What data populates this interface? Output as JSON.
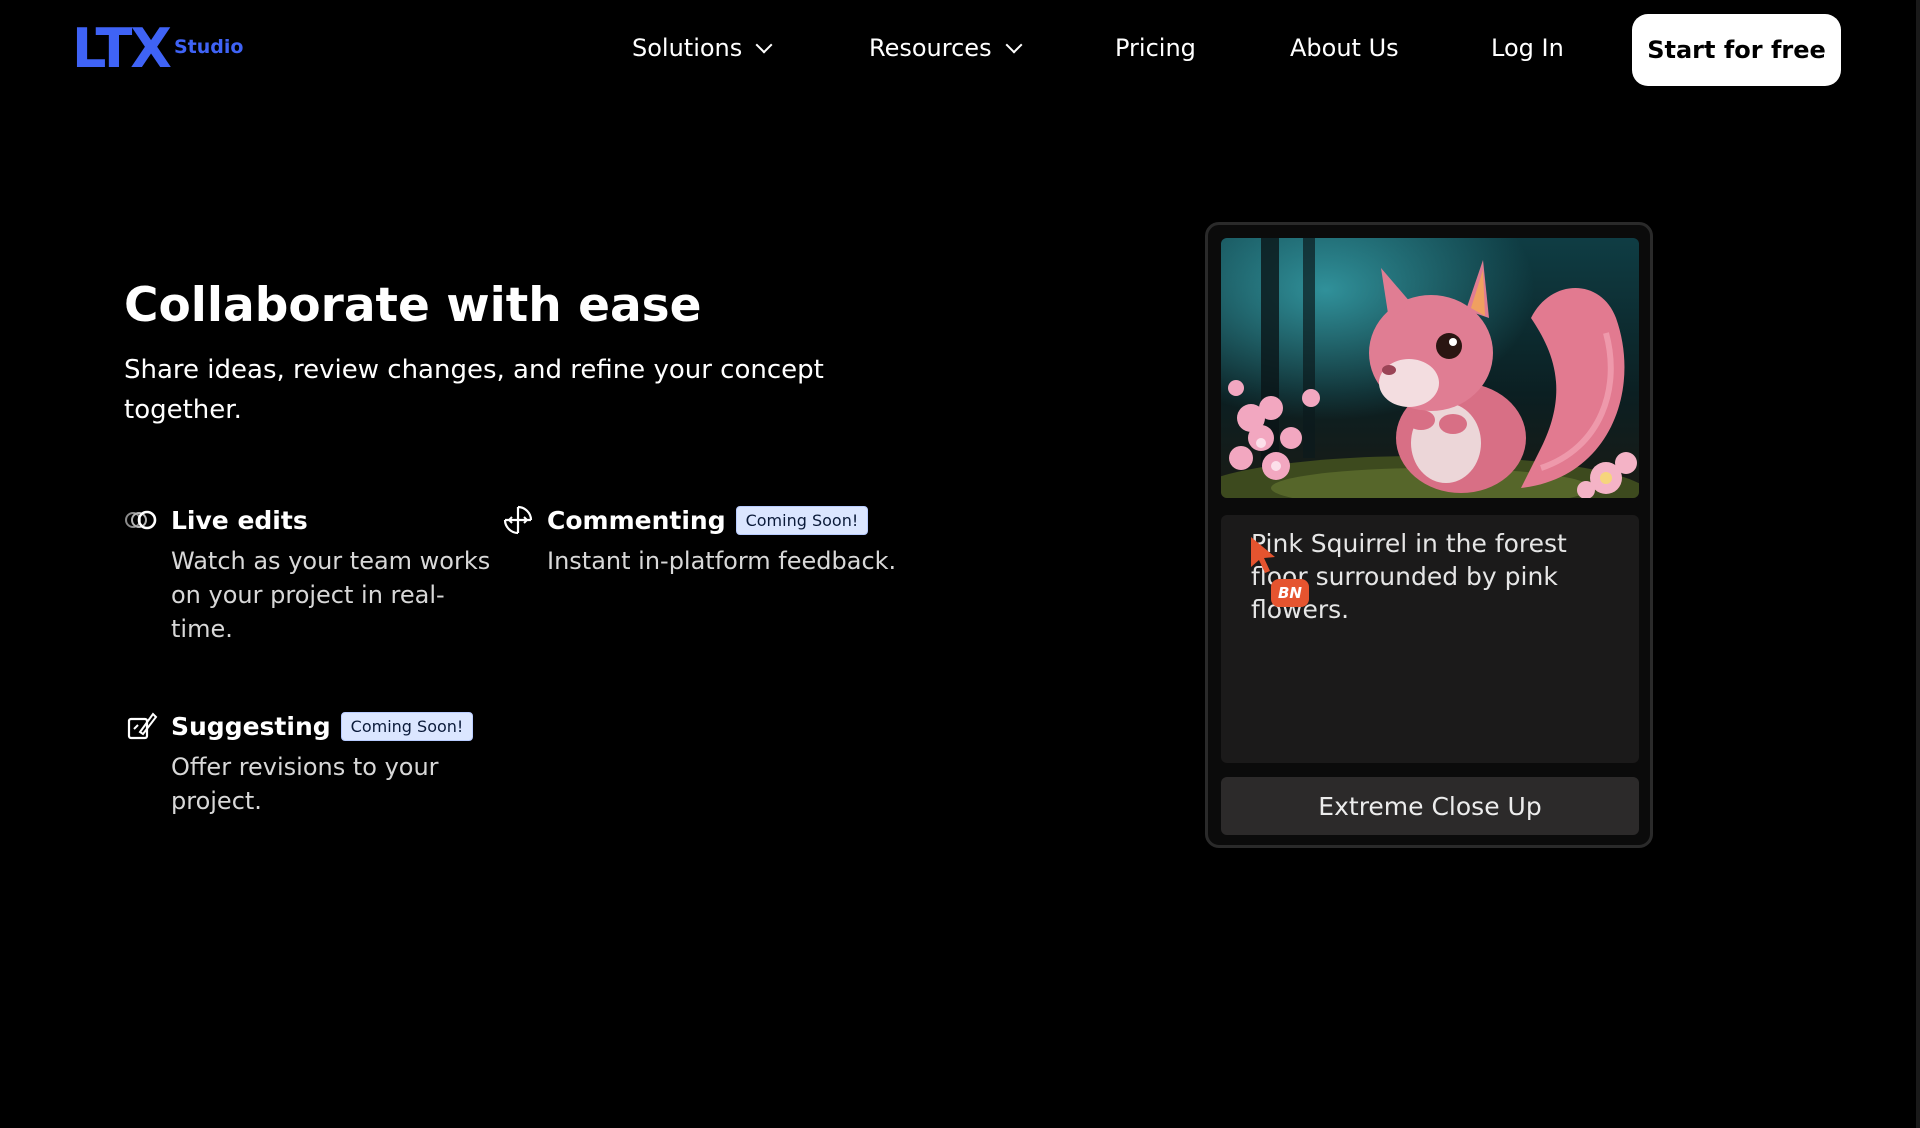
{
  "nav": {
    "logo_text": "LTX",
    "logo_sub": "Studio",
    "links": [
      {
        "label": "Solutions",
        "has_dropdown": true
      },
      {
        "label": "Resources",
        "has_dropdown": true
      },
      {
        "label": "Pricing"
      },
      {
        "label": "About Us"
      },
      {
        "label": "Log In"
      }
    ],
    "cta_label": "Start for free",
    "brand_color": "#3f63f6"
  },
  "hero": {
    "title": "Collaborate with ease",
    "subtitle": "Share ideas, review changes, and refine your concept together."
  },
  "features": [
    {
      "icon": "live-edits-icon",
      "title": "Live edits",
      "badge": "",
      "description": "Watch as your team works on your project in real-time."
    },
    {
      "icon": "commenting-icon",
      "title": "Commenting",
      "badge": "Coming Soon!",
      "description": "Instant in-platform feedback."
    },
    {
      "icon": "suggesting-icon",
      "title": "Suggesting",
      "badge": "Coming Soon!",
      "description": "Offer revisions to your project."
    }
  ],
  "card": {
    "image_subject": "pink-squirrel-illustration",
    "prompt": "Pink Squirrel in the forest floor surrounded by pink flowers.",
    "collaborator_initials": "BN",
    "shot_type": "Extreme Close Up"
  }
}
